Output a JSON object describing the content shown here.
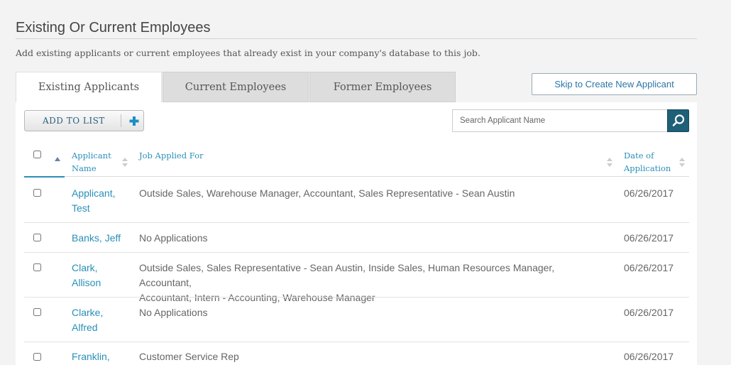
{
  "page": {
    "title": "Existing Or Current Employees",
    "subtitle": "Add existing applicants or current employees that already exist in your company's database to this job."
  },
  "tabs": [
    {
      "label": "Existing Applicants",
      "active": true
    },
    {
      "label": "Current Employees",
      "active": false
    },
    {
      "label": "Former Employees",
      "active": false
    }
  ],
  "skip_button": "Skip to Create New Applicant",
  "toolbar": {
    "add_to_list": "ADD TO LIST",
    "search_placeholder": "Search Applicant Name"
  },
  "table": {
    "headers": {
      "name_line1": "Applicant",
      "name_line2": "Name",
      "job": "Job Applied For",
      "date_line1": "Date of",
      "date_line2": "Application"
    },
    "rows": [
      {
        "name_line1": "Applicant,",
        "name_line2": "Test",
        "job_line1": "Outside Sales, Warehouse Manager, Accountant, Sales Representative - Sean Austin",
        "job_line2": "",
        "date": "06/26/2017"
      },
      {
        "name_line1": "Banks, Jeff",
        "name_line2": "",
        "job_line1": "No Applications",
        "job_line2": "",
        "date": "06/26/2017"
      },
      {
        "name_line1": "Clark,",
        "name_line2": "Allison",
        "job_line1": "Outside Sales, Sales Representative - Sean Austin, Inside Sales, Human Resources Manager, Accountant,",
        "job_line2": "Accountant, Intern - Accounting, Warehouse Manager",
        "date": "06/26/2017"
      },
      {
        "name_line1": "Clarke,",
        "name_line2": "Alfred",
        "job_line1": "No Applications",
        "job_line2": "",
        "date": "06/26/2017"
      },
      {
        "name_line1": "Franklin,",
        "name_line2": "",
        "job_line1": "Customer Service Rep",
        "job_line2": "",
        "date": "06/26/2017"
      }
    ]
  },
  "colors": {
    "link": "#2a8fb8",
    "search_button": "#1f5f78",
    "plus_icon": "#1a8fc4"
  },
  "icons": {
    "plus": "plus-icon",
    "search": "search-icon",
    "sort_up": "sort-ascending-icon",
    "sort": "sort-icon"
  }
}
